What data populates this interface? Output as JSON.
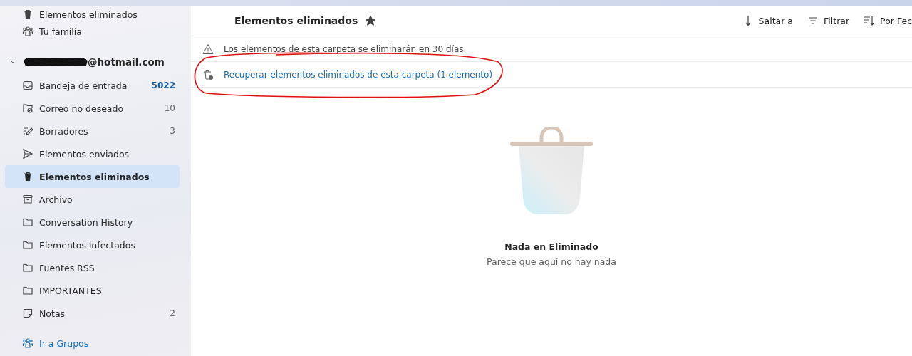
{
  "sidebar": {
    "top_items": [
      {
        "label": "Elementos eliminados",
        "kind": "trash"
      },
      {
        "label": "Tu familia",
        "kind": "people"
      }
    ],
    "account": {
      "label": "@hotmail.com",
      "expanded": true,
      "redacted": true
    },
    "folders": [
      {
        "label": "Bandeja de entrada",
        "kind": "inbox",
        "count": "5022",
        "unread": true,
        "selected": false
      },
      {
        "label": "Correo no deseado",
        "kind": "junk",
        "count": "10",
        "unread": false,
        "selected": false
      },
      {
        "label": "Borradores",
        "kind": "draft",
        "count": "3",
        "unread": false,
        "selected": false
      },
      {
        "label": "Elementos enviados",
        "kind": "sent",
        "selected": false
      },
      {
        "label": "Elementos eliminados",
        "kind": "trash",
        "selected": true
      },
      {
        "label": "Archivo",
        "kind": "archive",
        "selected": false
      },
      {
        "label": "Conversation History",
        "kind": "folder",
        "selected": false
      },
      {
        "label": "Elementos infectados",
        "kind": "folder",
        "selected": false
      },
      {
        "label": "Fuentes RSS",
        "kind": "folder",
        "selected": false
      },
      {
        "label": "IMPORTANTES",
        "kind": "folder",
        "selected": false
      },
      {
        "label": "Notas",
        "kind": "note",
        "count": "2",
        "unread": false,
        "selected": false
      }
    ],
    "groups_link": "Ir a Grupos"
  },
  "header": {
    "title": "Elementos eliminados",
    "favorite": true,
    "tools": [
      {
        "label": "Saltar a",
        "kind": "jump"
      },
      {
        "label": "Filtrar",
        "kind": "filter"
      },
      {
        "label": "Por Fec",
        "kind": "sort"
      }
    ]
  },
  "notice": "Los elementos de esta carpeta se eliminarán en 30 días.",
  "recover": {
    "label": "Recuperar elementos eliminados de esta carpeta (1 elemento)",
    "circled": true
  },
  "empty_state": {
    "title": "Nada en Eliminado",
    "subtitle": "Parece que aquí no hay nada"
  }
}
